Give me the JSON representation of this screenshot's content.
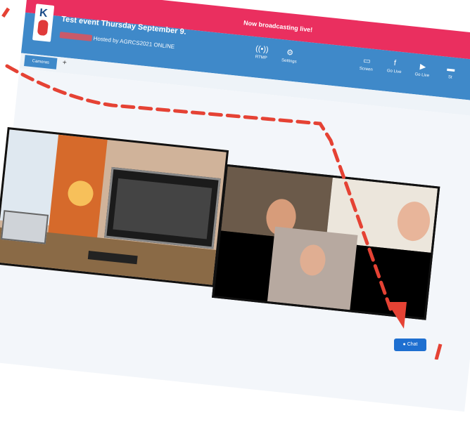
{
  "banner": {
    "text": "Now broadcasting live!"
  },
  "event": {
    "title": "Test event Thursday September 9.",
    "hosted_by": "Hosted by AGRCS2021 ONLINE"
  },
  "toolbar": {
    "items": [
      {
        "label": "RTMP",
        "icon": "broadcast-icon"
      },
      {
        "label": "Settings",
        "icon": "gear-icon"
      },
      {
        "label": "Screen",
        "icon": "monitor-icon"
      },
      {
        "label": "Go Live",
        "icon": "facebook-icon"
      },
      {
        "label": "Go Live",
        "icon": "youtube-icon"
      },
      {
        "label": "St",
        "icon": "stream-icon"
      }
    ]
  },
  "tabs": {
    "cameras": "Cameras",
    "add": "+"
  },
  "chat": {
    "label": "Chat"
  },
  "colors": {
    "banner": "#ea2f5f",
    "header": "#3f89c9",
    "arrow": "#e54234",
    "chat": "#1e6fd0"
  }
}
